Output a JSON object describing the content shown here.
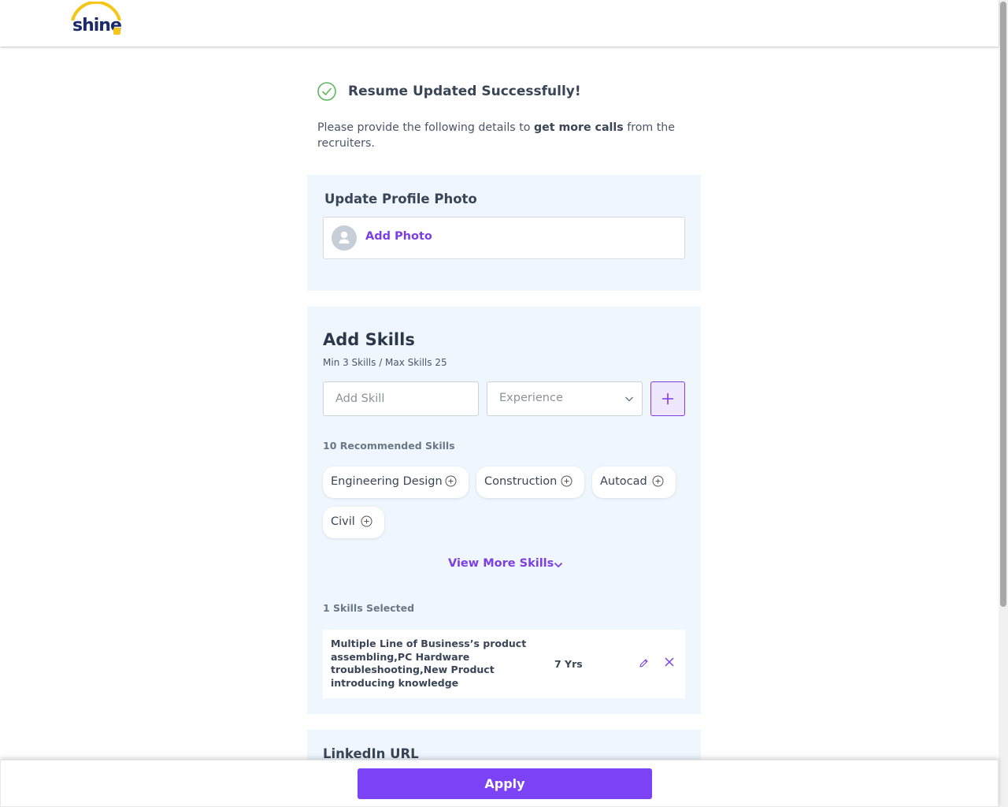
{
  "header": {
    "logo_text": "shine"
  },
  "success": {
    "title": "Resume Updated Successfully!",
    "intro_before": "Please provide the following details to ",
    "intro_bold": "get more calls",
    "intro_after": " from the recruiters."
  },
  "photo": {
    "title": "Update Profile Photo",
    "add_label": "Add Photo"
  },
  "skills": {
    "title": "Add Skills",
    "subtitle": "Min 3 Skills / Max Skills 25",
    "input_placeholder": "Add Skill",
    "experience_placeholder": "Experience",
    "recommended_label": "10 Recommended Skills",
    "recommended": [
      "Engineering Design",
      "Construction",
      "Autocad",
      "Civil"
    ],
    "view_more": "View More Skills",
    "selected_label": "1 Skills Selected",
    "selected": [
      {
        "name": "Multiple Line of Business’s product assembling,PC Hardware troubleshooting,New Product introducing knowledge",
        "experience": "7 Yrs"
      }
    ]
  },
  "linkedin": {
    "title": "LinkedIn URL"
  },
  "footer": {
    "apply_label": "Apply"
  },
  "colors": {
    "accent": "#7b42f6",
    "link": "#7b3fe4",
    "success": "#5cb85c",
    "card_bg": "#eff6fd"
  }
}
